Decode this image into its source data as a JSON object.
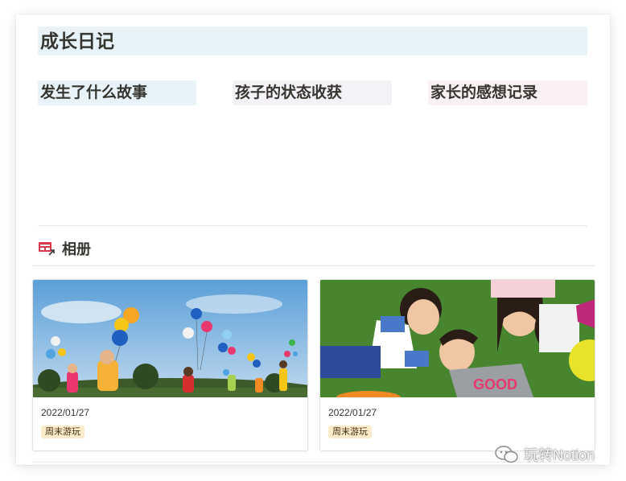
{
  "page": {
    "title": "成长日记",
    "columns": [
      {
        "heading": "发生了什么故事",
        "color": "#e7f3f8"
      },
      {
        "heading": "孩子的状态收获",
        "color": "#f4f2f7"
      },
      {
        "heading": "家长的感想记录",
        "color": "#fbf0f3"
      }
    ]
  },
  "gallery": {
    "icon": "gallery-view-icon",
    "title": "相册",
    "cards": [
      {
        "cover": "children-with-balloons-photo",
        "date": "2022/01/27",
        "tag": "周末游玩",
        "tag_color": "#fbeccc"
      },
      {
        "cover": "kids-lying-on-grass-photo",
        "date": "2022/01/27",
        "tag": "周末游玩",
        "tag_color": "#fbeccc"
      }
    ]
  },
  "watermark": {
    "icon": "wechat-icon",
    "text": "玩转Notion"
  }
}
